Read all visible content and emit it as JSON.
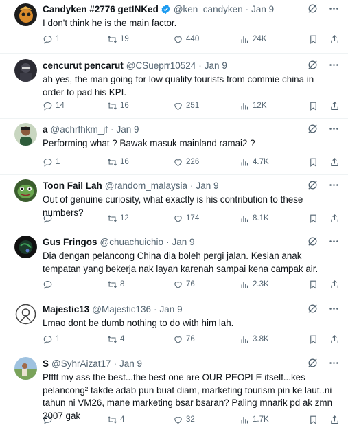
{
  "tweets": [
    {
      "name": "Candyken #2776 getINKed",
      "verified": true,
      "handle": "@ken_candyken",
      "time": "Jan 9",
      "text": "I don't think he is the main factor.",
      "replies": "1",
      "retweets": "19",
      "likes": "440",
      "views": "24K",
      "avatar": "cartoon-character-avatar"
    },
    {
      "name": "cencurut pencarut",
      "verified": false,
      "handle": "@CSueprr10524",
      "time": "Jan 9",
      "text": "ah yes, the man going for low quality tourists from commie china in order to pad his KPI.",
      "replies": "14",
      "retweets": "16",
      "likes": "251",
      "views": "12K",
      "avatar": "dark-character-avatar"
    },
    {
      "name": "a",
      "verified": false,
      "handle": "@achrfhkm_jf",
      "time": "Jan 9",
      "text": "Performing what ? Bawak masuk mainland ramai2 ?",
      "replies": "1",
      "retweets": "16",
      "likes": "226",
      "views": "4.7K",
      "avatar": "person-photo-avatar"
    },
    {
      "name": "Toon Fail Lah",
      "verified": false,
      "handle": "@random_malaysia",
      "time": "Jan 9",
      "text": "Out of genuine curiosity, what exactly is his contribution to these numbers?",
      "replies": "",
      "retweets": "12",
      "likes": "174",
      "views": "8.1K",
      "avatar": "green-frog-avatar"
    },
    {
      "name": "Gus Fringos",
      "verified": false,
      "handle": "@chuachuichio",
      "time": "Jan 9",
      "text": "Dia dengan pelancong China dia boleh pergi jalan. Kesian anak tempatan yang bekerja nak layan karenah sampai kena campak air.",
      "replies": "",
      "retweets": "8",
      "likes": "76",
      "views": "2.3K",
      "avatar": "dark-globe-avatar"
    },
    {
      "name": "Majestic13",
      "verified": false,
      "handle": "@Majestic136",
      "time": "Jan 9",
      "text": "Lmao dont be dumb nothing to do with him lah.",
      "replies": "1",
      "retweets": "4",
      "likes": "76",
      "views": "3.8K",
      "avatar": "emblem-avatar"
    },
    {
      "name": "S",
      "verified": false,
      "handle": "@SyhrAizat17",
      "time": "Jan 9",
      "text": "Pffft my ass the best...the best one are OUR PEOPLE itself...kes pelancong² takde adab pun buat diam, marketing tourism pin ke laut..ni tahun ni VM26, mane marketing bsar bsaran? Paling mnarik pd ak zmn 2007 gak",
      "replies": "",
      "retweets": "4",
      "likes": "32",
      "views": "1.7K",
      "avatar": "outdoor-photo-avatar"
    }
  ]
}
